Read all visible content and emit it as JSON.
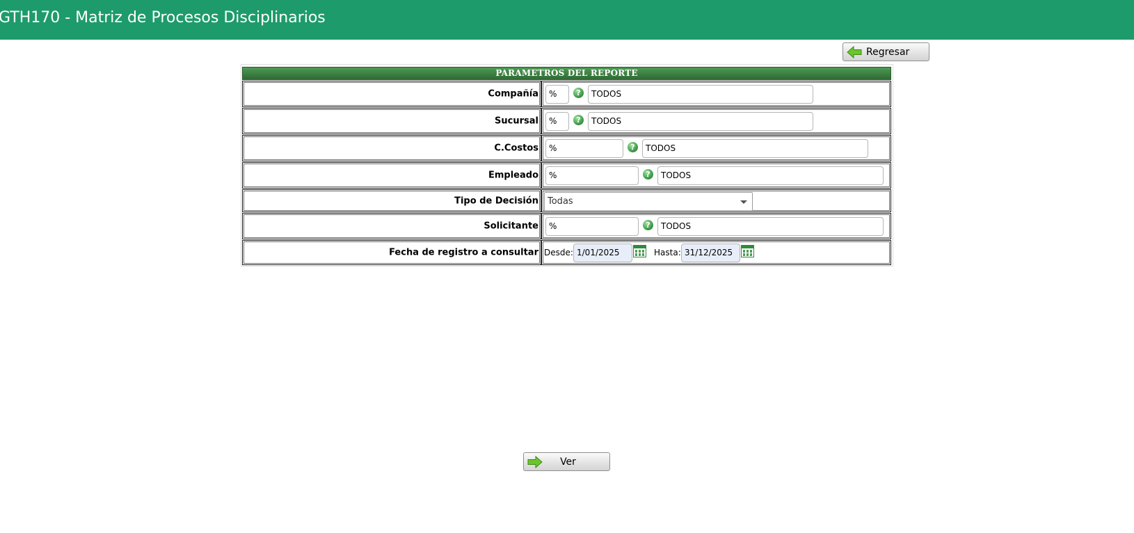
{
  "app": {
    "title": "GTH170 - Matriz de Procesos Disciplinarios"
  },
  "colors": {
    "header_bg": "#1e9b6b",
    "panel_header": "#3a7d40",
    "accent_icon": "#2f8a3a"
  },
  "buttons": {
    "back_label": "Regresar",
    "view_label": "Ver"
  },
  "panel": {
    "title": "PARAMETROS DEL REPORTE"
  },
  "form": {
    "company": {
      "label": "Compañía",
      "code": "%",
      "name": "TODOS"
    },
    "branch": {
      "label": "Sucursal",
      "code": "%",
      "name": "TODOS"
    },
    "cost_center": {
      "label": "C.Costos",
      "code": "%",
      "name": "TODOS"
    },
    "employee": {
      "label": "Empleado",
      "code": "%",
      "name": "TODOS"
    },
    "decision_type": {
      "label": "Tipo de Decisión",
      "selected": "Todas"
    },
    "requester": {
      "label": "Solicitante",
      "code": "%",
      "name": "TODOS"
    },
    "date_range": {
      "label": "Fecha de registro a consultar",
      "from_label": "Desde:",
      "from_value": "1/01/2025",
      "to_label": "Hasta:",
      "to_value": "31/12/2025"
    }
  },
  "icons": {
    "back": "arrow-left-icon",
    "view": "arrow-right-icon",
    "help": "help-icon",
    "calendar": "calendar-icon",
    "dropdown": "chevron-down-icon"
  }
}
